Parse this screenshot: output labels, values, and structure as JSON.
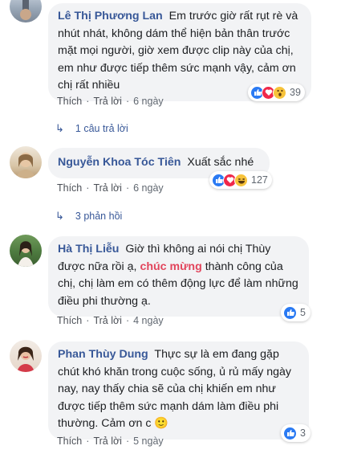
{
  "colors": {
    "author": "#385898",
    "highlight": "#e2455c",
    "like": "#2a7af3",
    "love": "#f0284a",
    "wow": "#f7c33b"
  },
  "comments": [
    {
      "author": "Lê Thị Phương Lan",
      "text": "Em trước giờ rất rụt rè và nhút nhát, không dám thể hiện bản thân trước mặt mọi người, giờ xem được clip này của chị, em như được tiếp thêm sức mạnh vậy, cảm ơn chị rất nhiều",
      "like": "Thích",
      "reply": "Trả lời",
      "time": "6 ngày",
      "reactions": [
        "like-icon",
        "love-icon",
        "wow-icon"
      ],
      "reaction_count": "39",
      "replies": "1 câu trả lời"
    },
    {
      "author": "Nguyễn Khoa Tóc Tiên",
      "text": "Xuất sắc nhé",
      "like": "Thích",
      "reply": "Trả lời",
      "time": "6 ngày",
      "reactions": [
        "like-icon",
        "love-icon",
        "haha-icon"
      ],
      "reaction_count": "127",
      "replies": "3 phản hồi"
    },
    {
      "author": "Hà Thị Liễu",
      "text_before": "Giờ thì không ai nói chị Thùy được nữa rồi ạ,",
      "text_highlight": "chúc mừng",
      "text_after": "thành công của chị, chị làm em có thêm động lực để làm những điều phi thường ạ.",
      "like": "Thích",
      "reply": "Trả lời",
      "time": "4 ngày",
      "reactions": [
        "like-icon"
      ],
      "reaction_count": "5"
    },
    {
      "author": "Phan Thùy Dung",
      "text": "Thực sự là em đang gặp chút khó khăn trong cuộc sống, ủ rủ mấy ngày nay, nay thấy chia sẽ của chị khiến em như được tiếp thêm sức mạnh dám làm điều phi thường. Cảm ơn c",
      "emoji": "🙂",
      "like": "Thích",
      "reply": "Trả lời",
      "time": "5 ngày",
      "reactions": [
        "like-icon"
      ],
      "reaction_count": "3"
    }
  ]
}
